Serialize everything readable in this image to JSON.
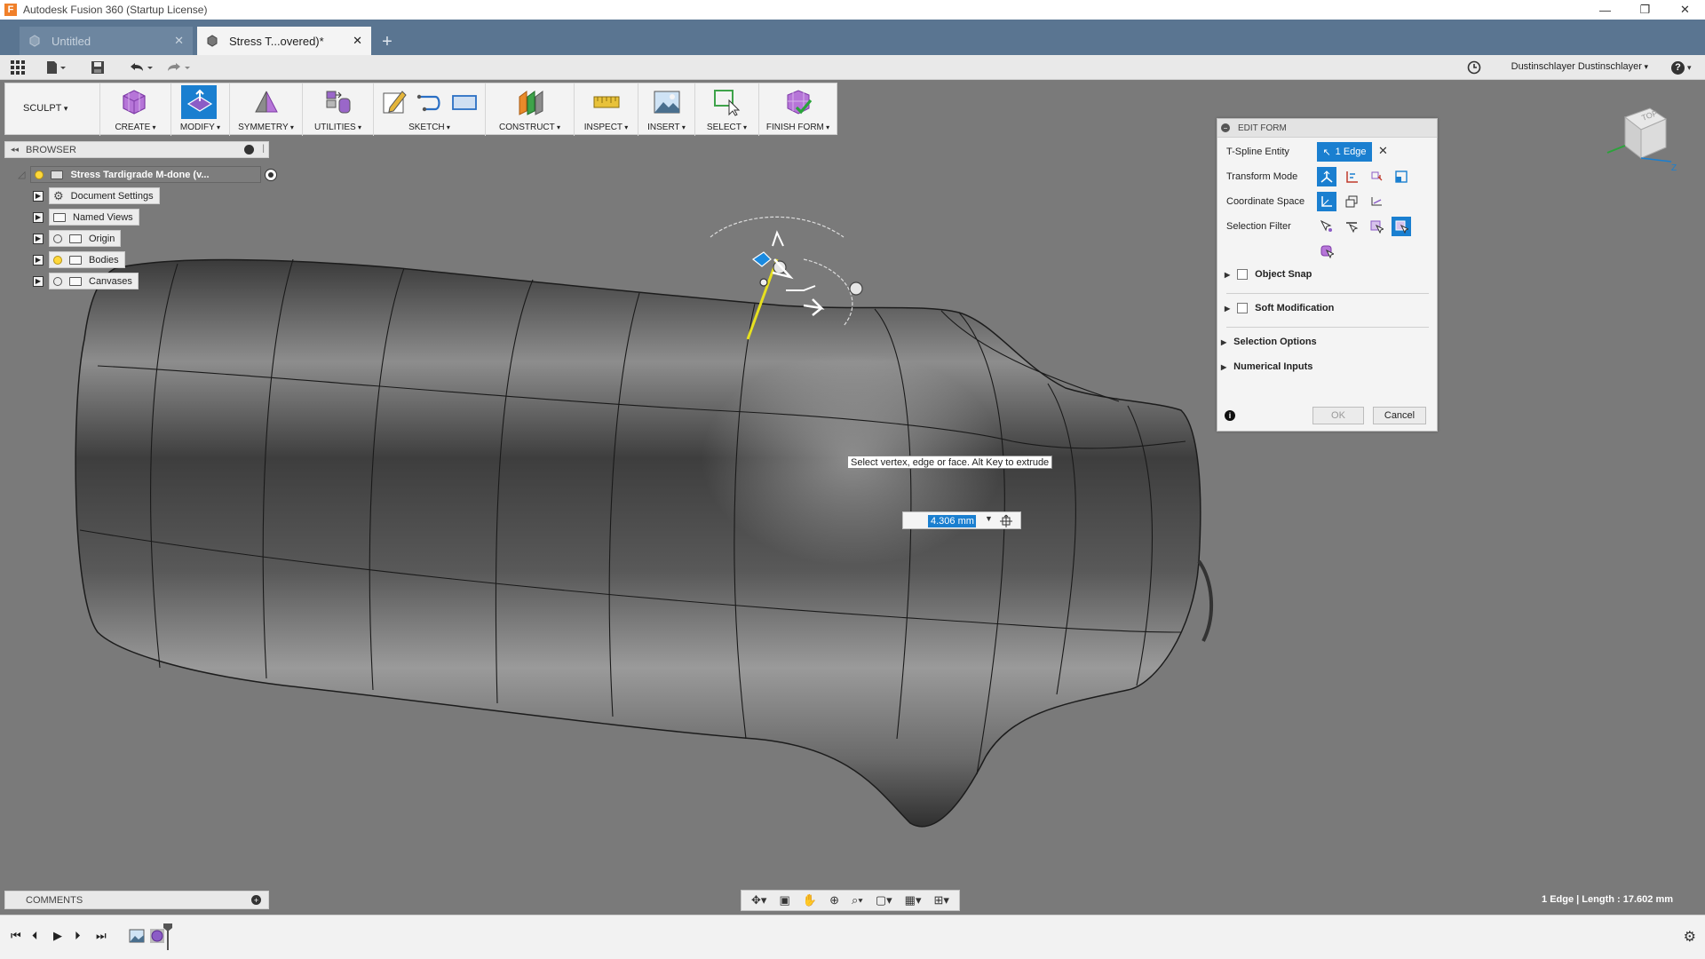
{
  "window": {
    "title": "Autodesk Fusion 360 (Startup License)",
    "logo": "F",
    "controls": {
      "minimize": "—",
      "restore": "❐",
      "close": "✕"
    }
  },
  "tabs": [
    {
      "label": "Untitled",
      "close": "✕"
    },
    {
      "label": "Stress T...overed)*",
      "close": "✕"
    }
  ],
  "new_tab": "+",
  "quick_access": {
    "user": "Dustinschlayer Dustinschlayer",
    "help": "?"
  },
  "toolbar": {
    "workspace": "SCULPT",
    "groups": [
      {
        "label": "CREATE"
      },
      {
        "label": "MODIFY"
      },
      {
        "label": "SYMMETRY"
      },
      {
        "label": "UTILITIES"
      },
      {
        "label": "SKETCH"
      },
      {
        "label": "CONSTRUCT"
      },
      {
        "label": "INSPECT"
      },
      {
        "label": "INSERT"
      },
      {
        "label": "SELECT"
      },
      {
        "label": "FINISH FORM"
      }
    ]
  },
  "browser": {
    "title": "BROWSER",
    "root": "Stress Tardigrade M-done (v...",
    "items": [
      {
        "label": "Document Settings"
      },
      {
        "label": "Named Views"
      },
      {
        "label": "Origin"
      },
      {
        "label": "Bodies"
      },
      {
        "label": "Canvases"
      }
    ]
  },
  "edit_form": {
    "title": "EDIT FORM",
    "tspline_label": "T-Spline Entity",
    "tspline_value": "1 Edge",
    "transform_label": "Transform Mode",
    "coord_label": "Coordinate Space",
    "filter_label": "Selection Filter",
    "object_snap": "Object Snap",
    "soft_mod": "Soft Modification",
    "selection_options": "Selection Options",
    "numerical_inputs": "Numerical Inputs",
    "ok": "OK",
    "cancel": "Cancel",
    "info": "i"
  },
  "viewport": {
    "tooltip": "Select vertex, edge or face. Alt Key to extrude",
    "dimension_value": "4.306 mm"
  },
  "comments": {
    "title": "COMMENTS",
    "plus": "+"
  },
  "status": "1 Edge | Length : 17.602 mm",
  "colors": {
    "accent": "#1a7fd0",
    "tab_bar": "#5a7591",
    "viewport_bg": "#7a7a7a",
    "edge_highlight": "#e6e020"
  }
}
